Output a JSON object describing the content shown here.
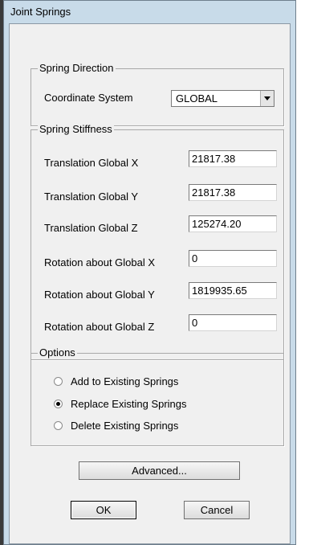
{
  "window": {
    "title": "Joint Springs"
  },
  "spring_direction": {
    "legend": "Spring Direction",
    "coordinate_system_label": "Coordinate System",
    "coordinate_system_value": "GLOBAL"
  },
  "spring_stiffness": {
    "legend": "Spring Stiffness",
    "rows": [
      {
        "label": "Translation Global X",
        "value": "21817.38"
      },
      {
        "label": "Translation Global Y",
        "value": "21817.38"
      },
      {
        "label": "Translation Global Z",
        "value": "125274.20"
      },
      {
        "label": "Rotation about Global X",
        "value": "0"
      },
      {
        "label": "Rotation about Global Y",
        "value": "1819935.65"
      },
      {
        "label": "Rotation about Global Z",
        "value": "0"
      }
    ]
  },
  "options": {
    "legend": "Options",
    "items": [
      {
        "label": "Add to Existing Springs",
        "checked": false
      },
      {
        "label": "Replace Existing Springs",
        "checked": true
      },
      {
        "label": "Delete Existing Springs",
        "checked": false
      }
    ]
  },
  "buttons": {
    "advanced": "Advanced...",
    "ok": "OK",
    "cancel": "Cancel"
  }
}
